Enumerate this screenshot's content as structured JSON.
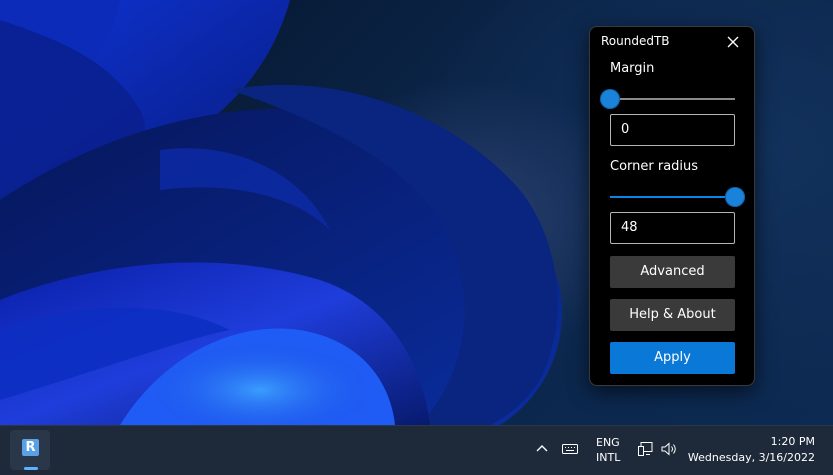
{
  "window": {
    "title": "RoundedTB",
    "close_icon": "close-icon",
    "margin": {
      "label": "Margin",
      "value": "0",
      "slider_fraction": 0.0
    },
    "corner_radius": {
      "label": "Corner radius",
      "value": "48",
      "slider_fraction": 1.0
    },
    "buttons": {
      "advanced": "Advanced",
      "help_about": "Help & About",
      "apply": "Apply"
    },
    "accent_color": "#0a78d7"
  },
  "taskbar": {
    "app_icon": {
      "name": "roundedtb-app-icon",
      "glyph": "R"
    },
    "tray": {
      "chevron_icon": "chevron-up-icon",
      "keyboard_icon": "keyboard-icon",
      "language_line1": "ENG",
      "language_line2": "INTL",
      "network_icon": "network-icon",
      "volume_icon": "volume-icon"
    },
    "clock": {
      "time": "1:20 PM",
      "date": "Wednesday, 3/16/2022"
    }
  }
}
